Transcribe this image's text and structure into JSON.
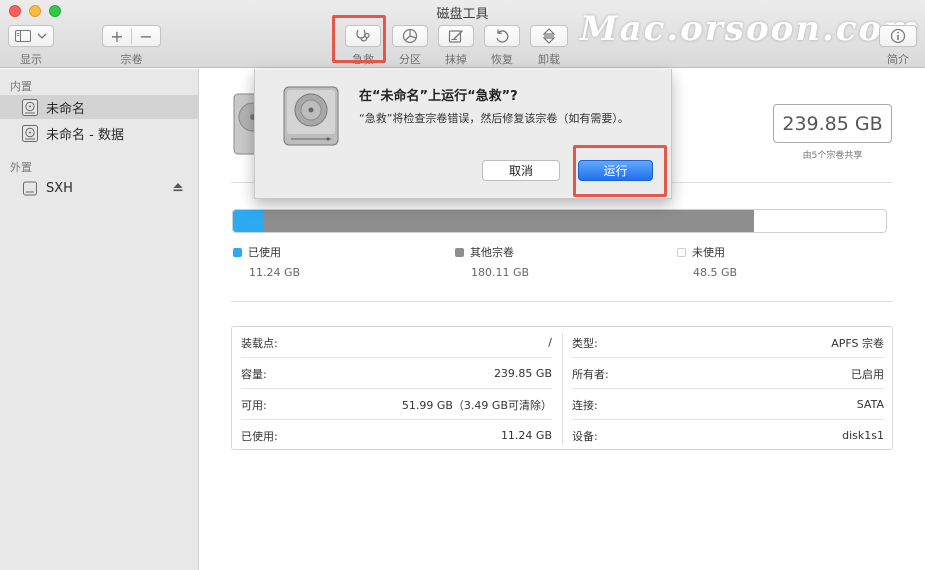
{
  "window": {
    "title": "磁盘工具"
  },
  "watermark": "Mac.orsoon.com",
  "toolbar": {
    "view_label": "显示",
    "volume_label": "宗卷",
    "add_symbol": "+",
    "remove_symbol": "−",
    "first_aid_label": "急救",
    "partition_label": "分区",
    "erase_label": "抹掉",
    "restore_label": "恢复",
    "unmount_label": "卸载",
    "info_label": "简介"
  },
  "sidebar": {
    "internal_header": "内置",
    "external_header": "外置",
    "items": [
      {
        "label": "未命名",
        "selected": true
      },
      {
        "label": "未命名 - 数据",
        "selected": false
      },
      {
        "label": "SXH",
        "selected": false
      }
    ]
  },
  "volume": {
    "capacity": "239.85 GB",
    "capacity_note": "由5个宗卷共享"
  },
  "usage": {
    "legend": [
      {
        "label": "已使用",
        "value": "11.24 GB",
        "color": "#2eaaf0",
        "gb": 11.24
      },
      {
        "label": "其他宗卷",
        "value": "180.11 GB",
        "color": "#8e8e8e",
        "gb": 180.11
      },
      {
        "label": "未使用",
        "value": "48.5 GB",
        "color": "#ffffff",
        "gb": 48.5
      }
    ]
  },
  "info": {
    "left": [
      {
        "key": "装载点:",
        "value": "/"
      },
      {
        "key": "容量:",
        "value": "239.85 GB"
      },
      {
        "key": "可用:",
        "value": "51.99 GB（3.49 GB可清除）"
      },
      {
        "key": "已使用:",
        "value": "11.24 GB"
      }
    ],
    "right": [
      {
        "key": "类型:",
        "value": "APFS 宗卷"
      },
      {
        "key": "所有者:",
        "value": "已启用"
      },
      {
        "key": "连接:",
        "value": "SATA"
      },
      {
        "key": "设备:",
        "value": "disk1s1"
      }
    ]
  },
  "dialog": {
    "title": "在“未命名”上运行“急救”?",
    "message": "“急救”将检查宗卷错误，然后修复该宗卷（如有需要）。",
    "cancel_label": "取消",
    "run_label": "运行"
  },
  "colors": {
    "highlight": "#e3574c",
    "accent": "#1f6ff0"
  }
}
